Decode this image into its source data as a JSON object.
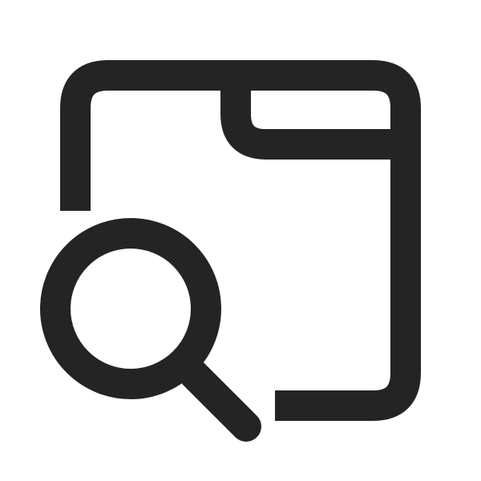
{
  "icon": {
    "name": "window-search-icon",
    "color": "#242424",
    "background": "#ffffff"
  }
}
